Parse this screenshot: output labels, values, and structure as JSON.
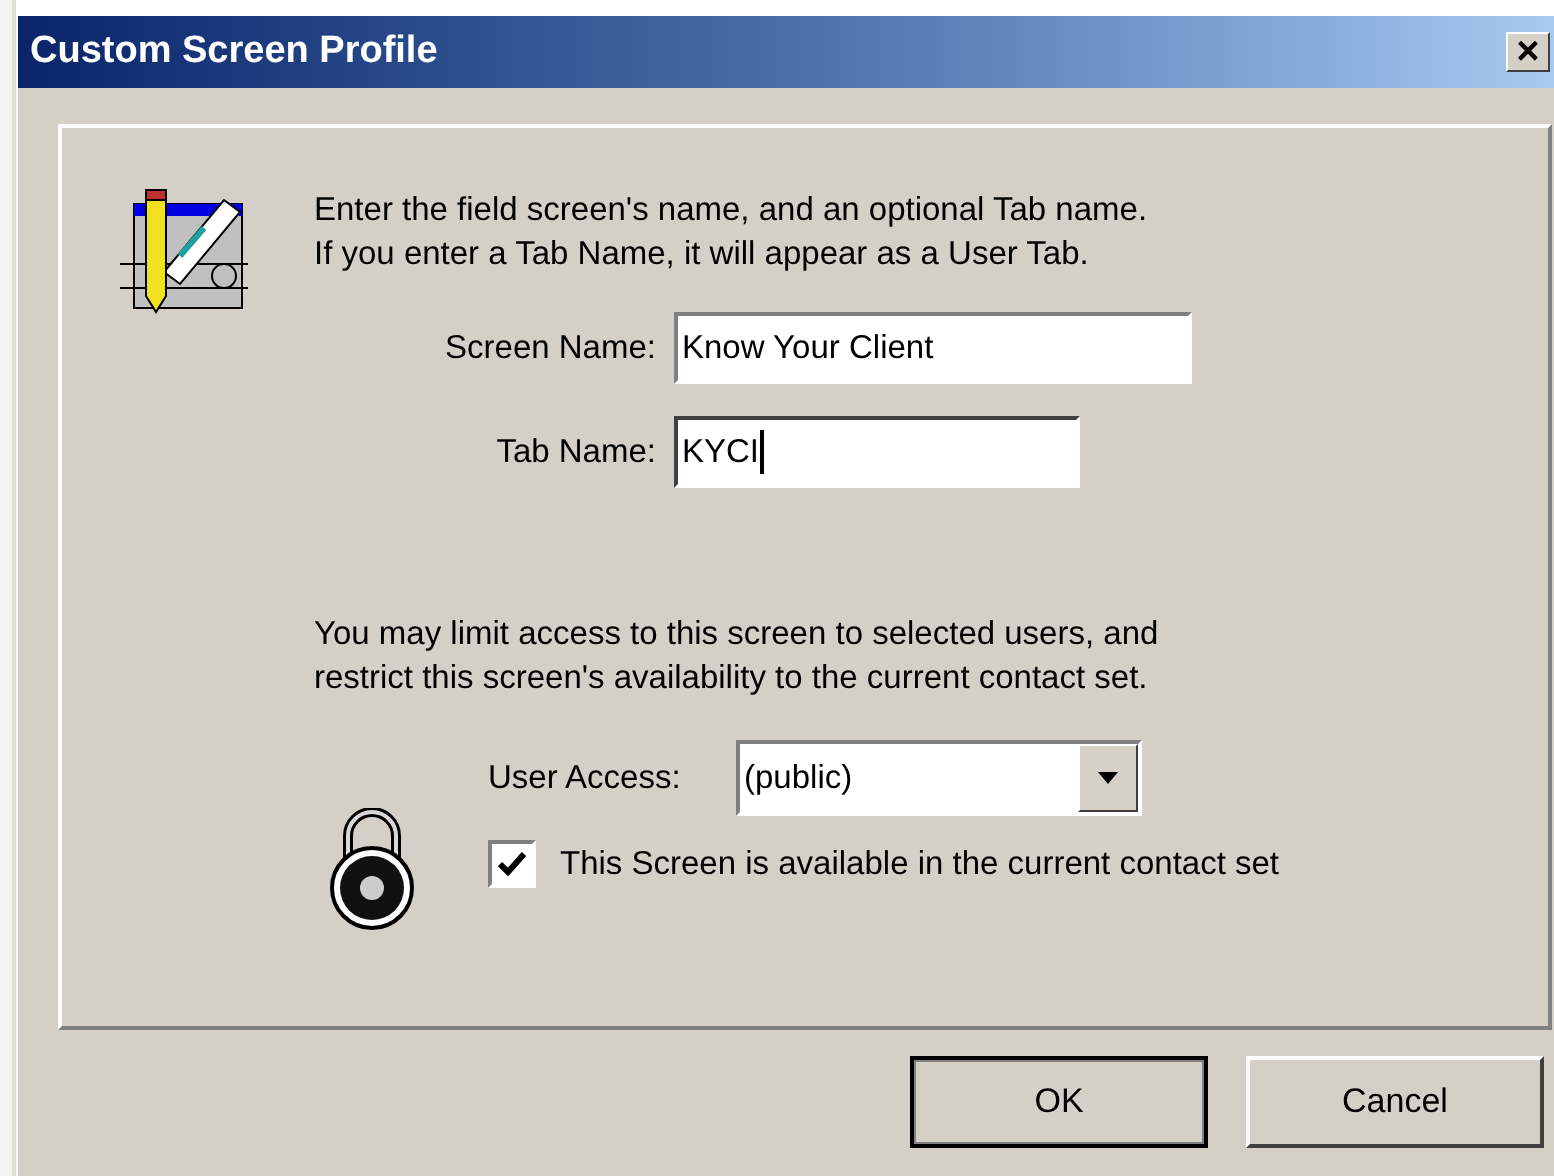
{
  "window": {
    "title": "Custom Screen Profile",
    "close": "×"
  },
  "intro": [
    "Enter the field screen's name, and an optional Tab name.",
    "If you enter a Tab Name, it will appear as a User Tab."
  ],
  "fields": [
    {
      "label": "Screen Name:",
      "value": "Know Your Client",
      "focused": false
    },
    {
      "label": "Tab Name:",
      "value": "KYCI",
      "focused": true
    }
  ],
  "access_text": [
    "You may limit access to this screen to selected users, and",
    "restrict this screen's availability to the current contact set."
  ],
  "user_access": {
    "label": "User Access:",
    "value": "(public)"
  },
  "contact_set": {
    "label": "This Screen is available in the current contact set",
    "checked": true
  },
  "buttons": [
    {
      "label": "OK",
      "default": true
    },
    {
      "label": "Cancel",
      "default": false
    }
  ]
}
